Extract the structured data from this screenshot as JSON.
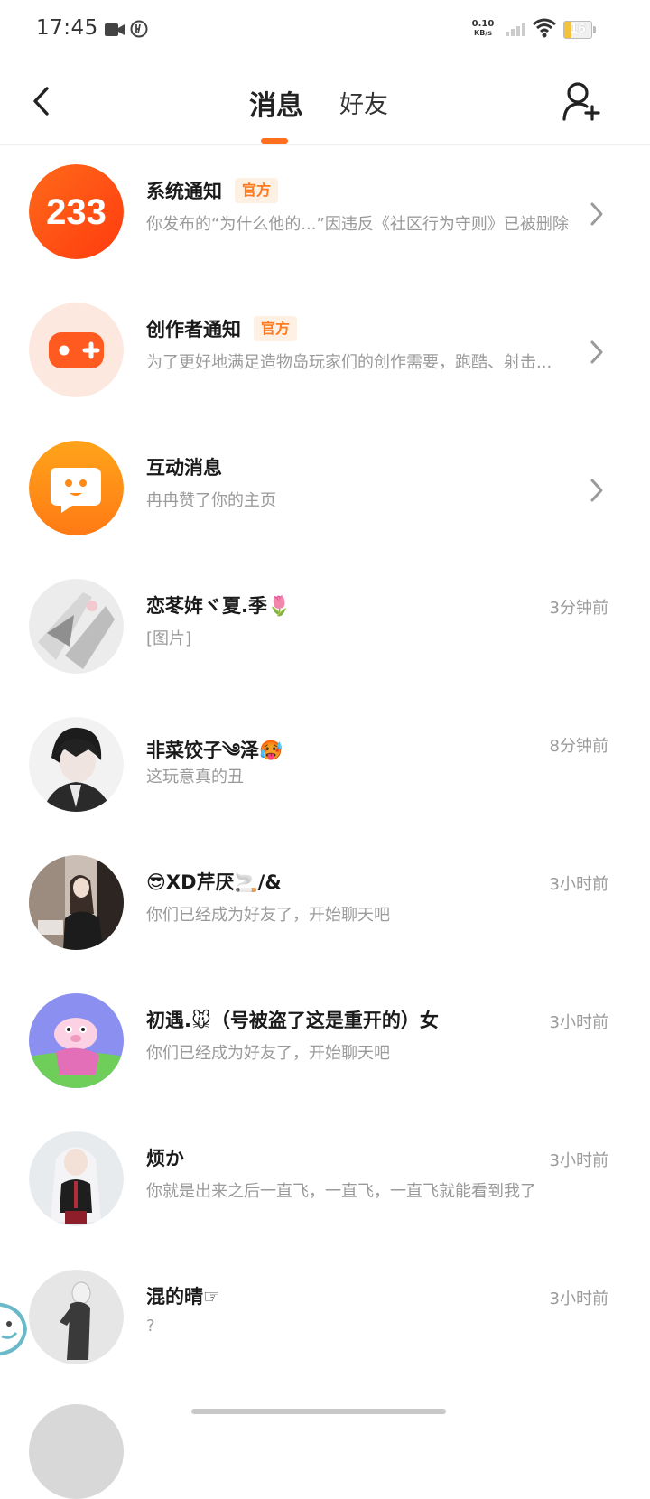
{
  "status_bar": {
    "time": "17:45",
    "net_speed_value": "0.10",
    "net_speed_unit": "KB/s",
    "battery": "16",
    "icons": [
      "video-camera-icon",
      "hd-icon",
      "signal-icon",
      "wifi-icon",
      "battery-icon"
    ]
  },
  "header": {
    "tabs": [
      "消息",
      "好友"
    ],
    "active_tab": "消息",
    "accent_color": "#ff6f1d",
    "icons": [
      "back-arrow-icon",
      "add-friend-icon"
    ]
  },
  "messages": [
    {
      "name": "系统通知",
      "badge": "官方",
      "preview": "你发布的“为什么他的...”因违反《社区行为守则》已被删除",
      "time": "",
      "has_chevron": true,
      "avatar": "233-logo"
    },
    {
      "name": "创作者通知",
      "badge": "官方",
      "preview": "为了更好地满足造物岛玩家们的创作需要，跑酷、射击...",
      "time": "",
      "has_chevron": true,
      "avatar": "gamepad-icon"
    },
    {
      "name": "互动消息",
      "badge": "",
      "preview": "冉冉赞了你的主页",
      "time": "",
      "has_chevron": true,
      "avatar": "chat-bubble-icon"
    },
    {
      "name": "恋苳姩ヾ夏.季🌷",
      "badge": "",
      "preview": "[图片]",
      "time": "3分钟前",
      "has_chevron": false,
      "avatar": "user-avatar"
    },
    {
      "name": "非菜饺子༄泽🥵",
      "badge": "",
      "preview": "这玩意真的丑",
      "time": "8分钟前",
      "has_chevron": false,
      "avatar": "user-avatar"
    },
    {
      "name": "😎XD芹厌🚬/&",
      "badge": "",
      "preview": "你们已经成为好友了，开始聊天吧",
      "time": "3小时前",
      "has_chevron": false,
      "avatar": "user-avatar"
    },
    {
      "name": "初遇.🐭（号被盗了这是重开的）女",
      "badge": "",
      "preview": "你们已经成为好友了，开始聊天吧",
      "time": "3小时前",
      "has_chevron": false,
      "avatar": "user-avatar"
    },
    {
      "name": "烦か",
      "badge": "",
      "preview": "你就是出来之后一直飞，一直飞，一直飞就能看到我了",
      "time": "3小时前",
      "has_chevron": false,
      "avatar": "user-avatar"
    },
    {
      "name": "混的晴☞",
      "badge": "",
      "preview": "?",
      "time": "3小时前",
      "has_chevron": false,
      "avatar": "user-avatar"
    }
  ]
}
